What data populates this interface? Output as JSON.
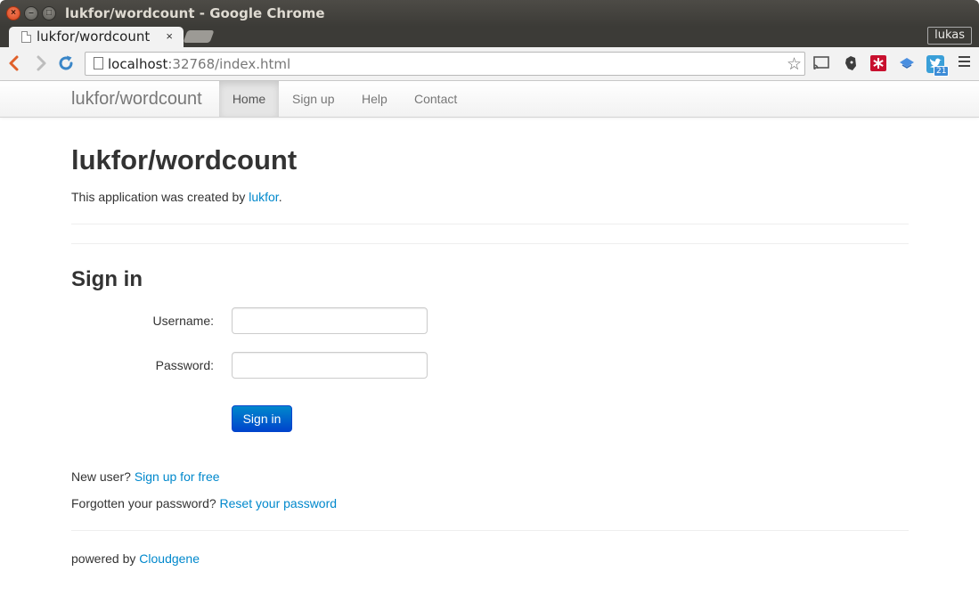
{
  "window": {
    "title": "lukfor/wordcount - Google Chrome"
  },
  "tab": {
    "title": "lukfor/wordcount",
    "close": "×"
  },
  "profile": "lukas",
  "address_bar": {
    "host": "localhost",
    "rest": ":32768/index.html"
  },
  "extensions": [
    {
      "name": "cast-icon"
    },
    {
      "name": "evernote-icon"
    },
    {
      "name": "lastpass-icon"
    },
    {
      "name": "bookmark-icon"
    },
    {
      "name": "twitter-icon",
      "badge": "21"
    }
  ],
  "navbar": {
    "brand": "lukfor/wordcount",
    "items": [
      {
        "label": "Home",
        "active": true
      },
      {
        "label": "Sign up"
      },
      {
        "label": "Help"
      },
      {
        "label": "Contact"
      }
    ]
  },
  "hero": {
    "title": "lukfor/wordcount",
    "intro_prefix": "This application was created by ",
    "intro_link": "lukfor",
    "intro_suffix": "."
  },
  "signin": {
    "heading": "Sign in",
    "username_label": "Username:",
    "username_value": "",
    "password_label": "Password:",
    "password_value": "",
    "button": "Sign in"
  },
  "links": {
    "new_user_prefix": "New user? ",
    "new_user_link": "Sign up for free",
    "forgot_prefix": "Forgotten your password? ",
    "forgot_link": "Reset your password"
  },
  "footer": {
    "prefix": "powered by ",
    "link": "Cloudgene"
  },
  "colors": {
    "link": "#0088cc",
    "primary_button": "#0055cc"
  }
}
